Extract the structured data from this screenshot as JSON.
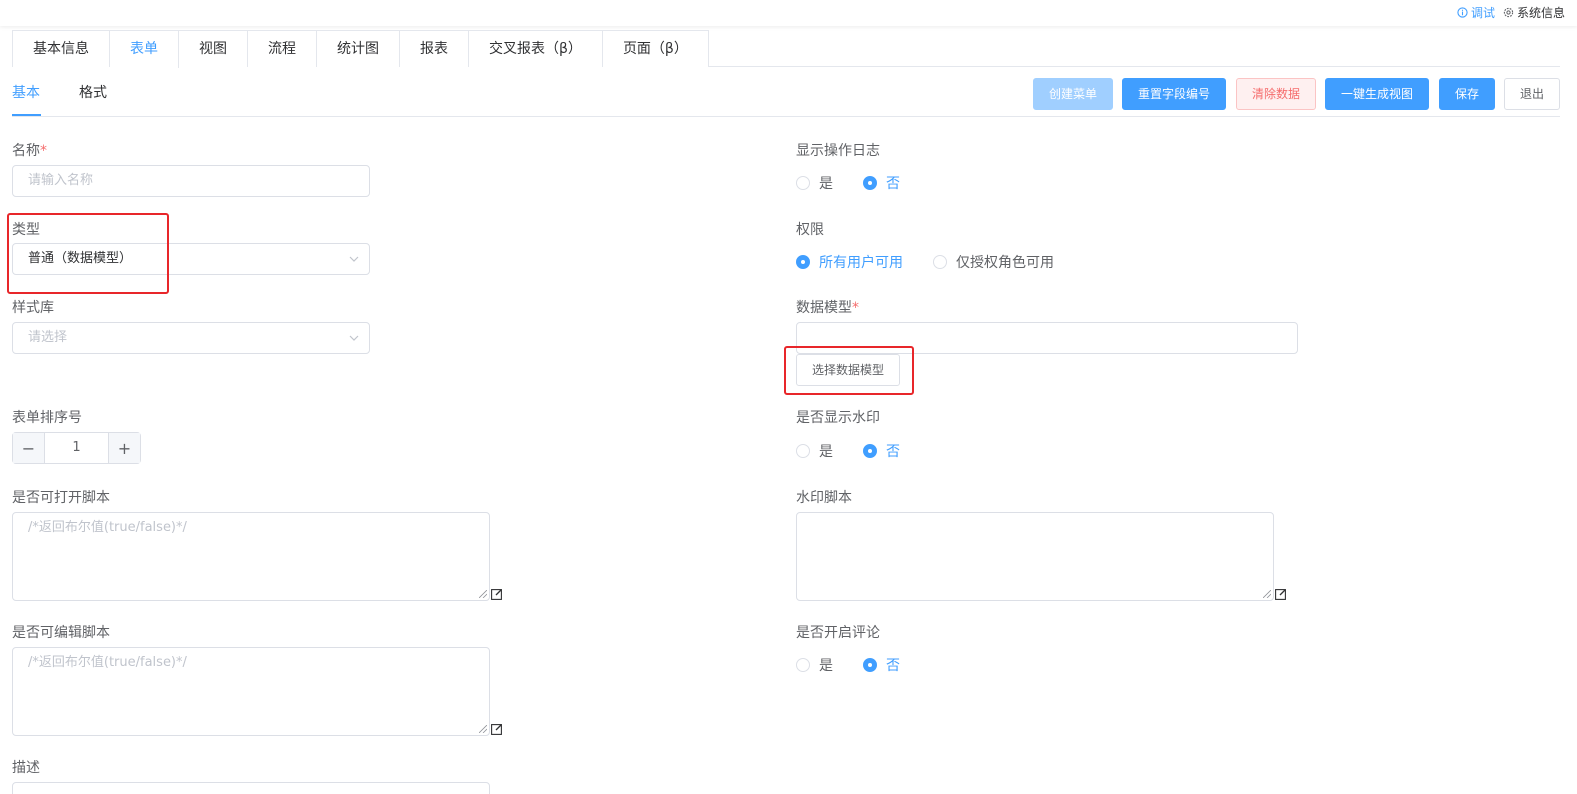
{
  "topbar": {
    "debug_label": "调试",
    "system_label": "系统信息"
  },
  "main_tabs": [
    {
      "label": "基本信息"
    },
    {
      "label": "表单"
    },
    {
      "label": "视图"
    },
    {
      "label": "流程"
    },
    {
      "label": "统计图"
    },
    {
      "label": "报表"
    },
    {
      "label": "交叉报表（β）"
    },
    {
      "label": "页面（β）"
    }
  ],
  "sub_tabs": [
    {
      "label": "基本"
    },
    {
      "label": "格式"
    }
  ],
  "toolbar": {
    "create_menu": "创建菜单",
    "reset_field_numbers": "重置字段编号",
    "clear_data": "清除数据",
    "generate_view": "一键生成视图",
    "save": "保存",
    "exit": "退出"
  },
  "form": {
    "name_label": "名称",
    "required_mark": "*",
    "name_placeholder": "请输入名称",
    "type_label": "类型",
    "type_value": "普通（数据模型）",
    "style_lib_label": "样式库",
    "style_lib_placeholder": "请选择",
    "sort_label": "表单排序号",
    "sort_value": "1",
    "can_open_label": "是否可打开脚本",
    "can_open_placeholder": "/*返回布尔值(true/false)*/",
    "can_edit_label": "是否可编辑脚本",
    "can_edit_placeholder": "/*返回布尔值(true/false)*/",
    "desc_label": "描述",
    "show_log_label": "显示操作日志",
    "yes": "是",
    "no": "否",
    "permission_label": "权限",
    "perm_all": "所有用户可用",
    "perm_role": "仅授权角色可用",
    "data_model_label": "数据模型",
    "select_data_model": "选择数据模型",
    "watermark_label": "是否显示水印",
    "watermark_script_label": "水印脚本",
    "comment_label": "是否开启评论"
  }
}
